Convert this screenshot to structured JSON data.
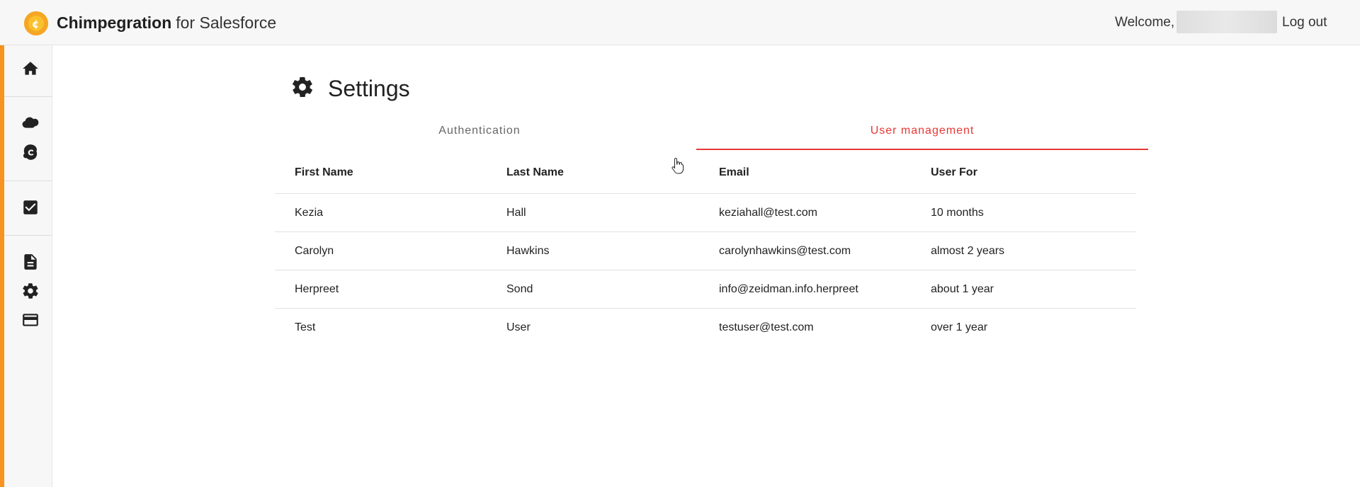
{
  "header": {
    "brand_bold": "Chimpegration",
    "brand_rest": "for Salesforce",
    "welcome_label": "Welcome,",
    "logout_label": "Log out"
  },
  "sidebar": {
    "items": [
      {
        "icon": "home-icon"
      },
      {
        "icon": "salesforce-cloud-icon"
      },
      {
        "icon": "mailchimp-icon"
      },
      {
        "icon": "checkbox-icon"
      },
      {
        "icon": "document-icon"
      },
      {
        "icon": "gear-icon"
      },
      {
        "icon": "credit-card-icon"
      }
    ],
    "accent_color": "#f7931e"
  },
  "page": {
    "title": "Settings",
    "title_icon": "gear-icon"
  },
  "tabs": [
    {
      "label": "Authentication",
      "active": false
    },
    {
      "label": "User management",
      "active": true
    }
  ],
  "accent_color": "#e53935",
  "table": {
    "columns": [
      "First Name",
      "Last Name",
      "Email",
      "User For"
    ],
    "rows": [
      [
        "Kezia",
        "Hall",
        "keziahall@test.com",
        "10 months"
      ],
      [
        "Carolyn",
        "Hawkins",
        "carolynhawkins@test.com",
        "almost 2 years"
      ],
      [
        "Herpreet",
        "Sond",
        "info@zeidman.info.herpreet",
        "about 1 year"
      ],
      [
        "Test",
        "User",
        "testuser@test.com",
        "over 1 year"
      ]
    ]
  }
}
